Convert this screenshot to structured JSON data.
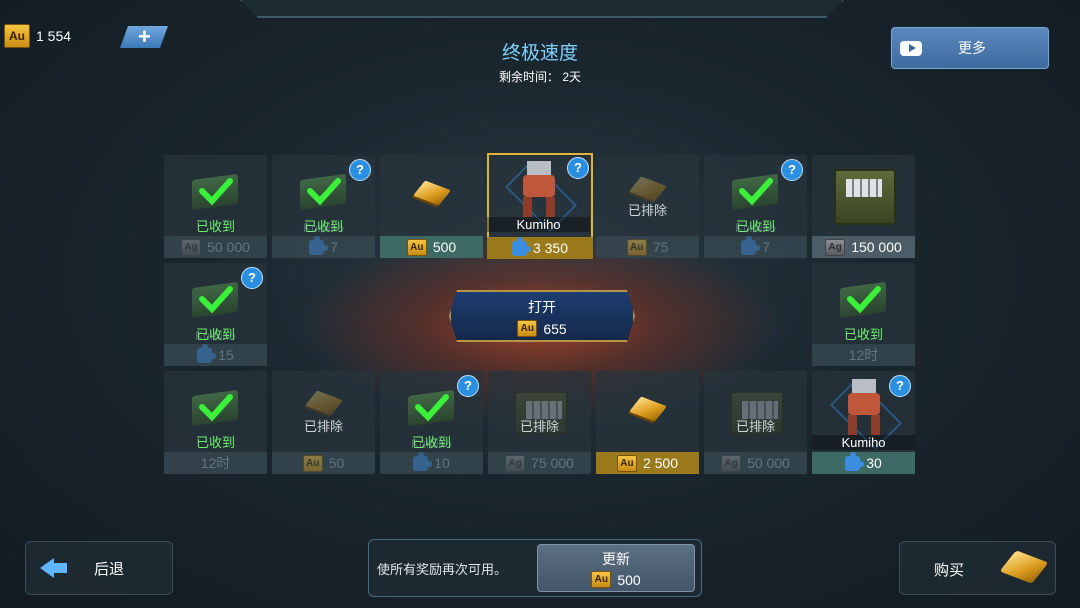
{
  "header": {
    "currency_code": "Au",
    "gold_balance": "1 554",
    "title": "终极速度",
    "time_label": "剩余时间：",
    "time_value": "2天",
    "more_label": "更多"
  },
  "colors": {
    "title": "#7fd0ff",
    "received": "#6ef06e",
    "gold_footer": "#9a7a1a",
    "selected_border": "#e0b53a",
    "help_badge": "#2a8fe0"
  },
  "grid": {
    "row1": [
      {
        "status": "已收到",
        "currency": "Ag",
        "amount": "50 000"
      },
      {
        "status": "已收到",
        "ghost": "Kumiho",
        "currency": "puzzle",
        "amount": "7"
      },
      {
        "item": "gold-bar",
        "currency": "Au",
        "amount": "500"
      },
      {
        "item": "robot",
        "name": "Kumiho",
        "currency": "puzzle",
        "amount": "3 350"
      },
      {
        "status": "已排除",
        "currency": "Au",
        "amount": "75"
      },
      {
        "status": "已收到",
        "ghost": "Kumiho",
        "currency": "puzzle",
        "amount": "7"
      },
      {
        "item": "crate",
        "currency": "Ag",
        "amount": "150 000"
      }
    ],
    "row2_left": {
      "status": "已收到",
      "ghost": "Kumiho",
      "currency": "puzzle",
      "amount": "15"
    },
    "row2_right": {
      "status": "已收到",
      "amount": "12时"
    },
    "row3": [
      {
        "status": "已收到",
        "amount": "12时"
      },
      {
        "status": "已排除",
        "currency": "Au",
        "amount": "50"
      },
      {
        "status": "已收到",
        "ghost": "Kumiho",
        "currency": "puzzle",
        "amount": "10"
      },
      {
        "status": "已排除",
        "currency": "Ag",
        "amount": "75 000"
      },
      {
        "item": "gold-bar",
        "currency": "Au",
        "amount": "2 500"
      },
      {
        "status": "已排除",
        "currency": "Ag",
        "amount": "50 000"
      },
      {
        "item": "robot",
        "name": "Kumiho",
        "currency": "puzzle",
        "amount": "30"
      }
    ]
  },
  "open_button": {
    "label": "打开",
    "cost": "655"
  },
  "footer": {
    "back_label": "后退",
    "renew_text": "使所有奖励再次可用。",
    "renew_label": "更新",
    "renew_cost": "500",
    "buy_label": "购买"
  }
}
